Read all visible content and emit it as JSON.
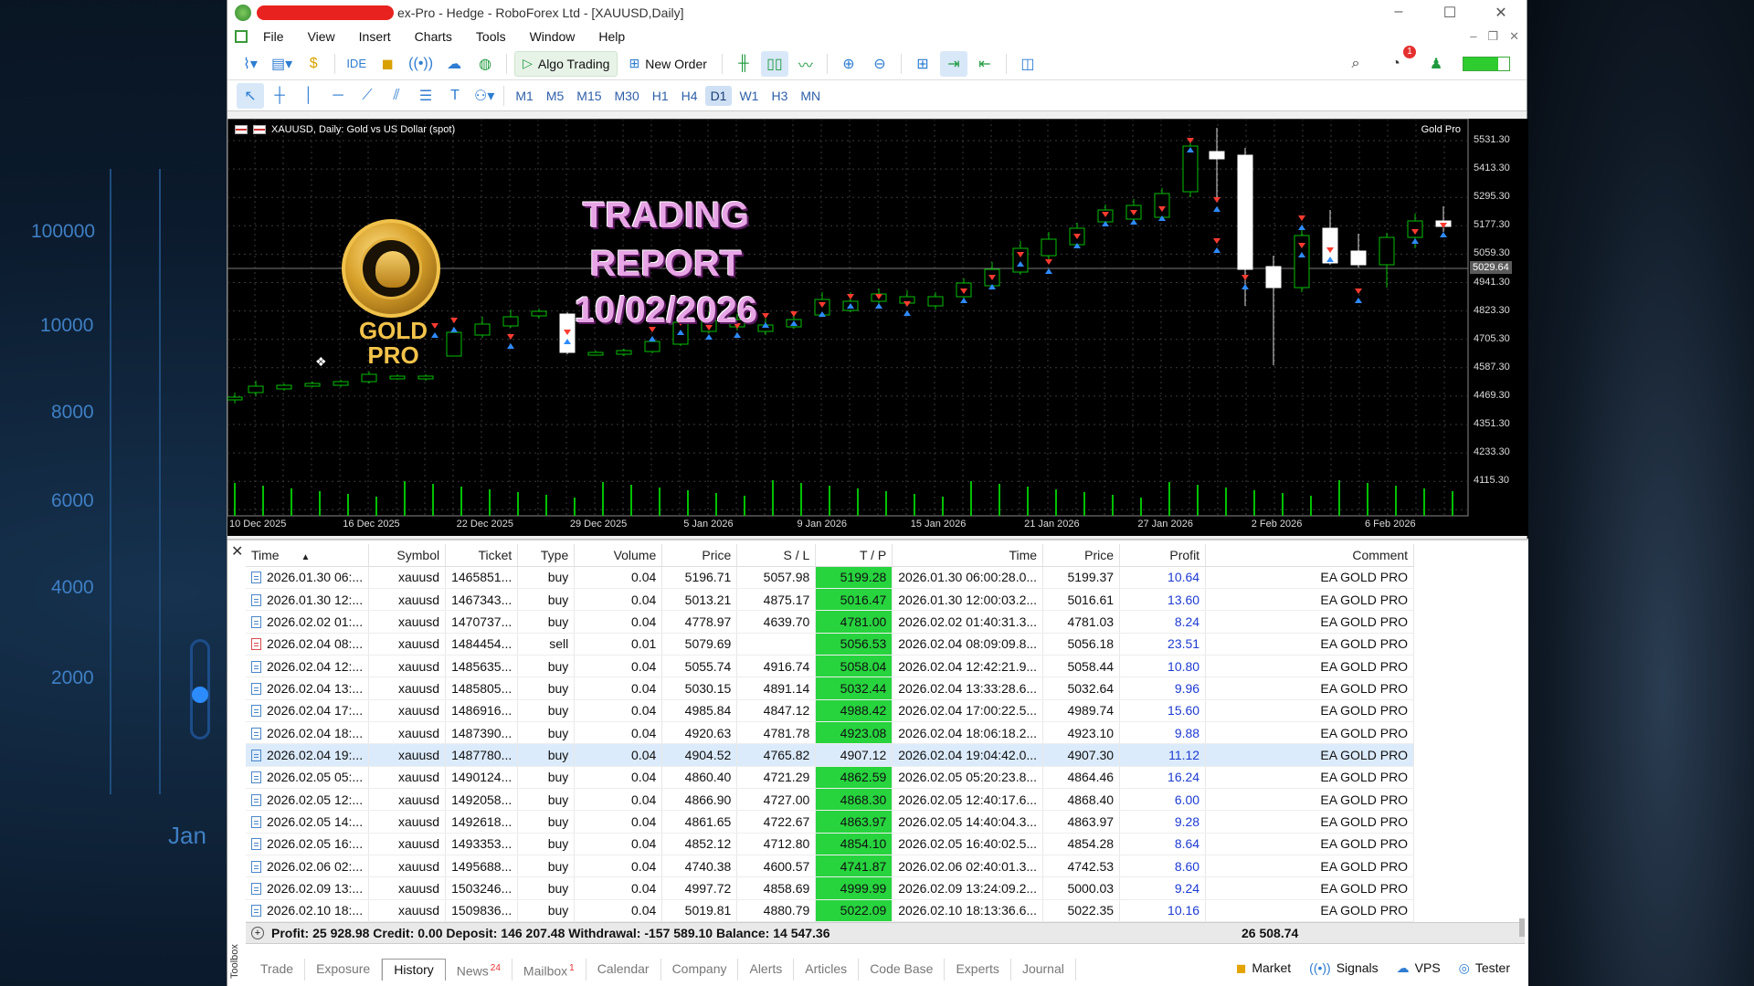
{
  "background": {
    "axis_labels": [
      "100000",
      "10000",
      "8000",
      "6000",
      "4000",
      "2000",
      "Jan"
    ]
  },
  "window": {
    "title": "ex-Pro - Hedge - RoboForex Ltd - [XAUUSD,Daily]",
    "controls": [
      "–",
      "☐",
      "✕"
    ]
  },
  "menu": [
    "File",
    "View",
    "Insert",
    "Charts",
    "Tools",
    "Window",
    "Help"
  ],
  "toolbar": {
    "ide_label": "IDE",
    "algo_trading_label": "Algo Trading",
    "new_order_label": "New Order",
    "notification_count": "1"
  },
  "timeframes": [
    "M1",
    "M5",
    "M15",
    "M30",
    "H1",
    "H4",
    "D1",
    "W1",
    "H3",
    "MN"
  ],
  "chart": {
    "header": "XAUUSD, Daily:  Gold vs US Dollar (spot)",
    "ea_name": "Gold Pro",
    "current_price": "5029.64",
    "y_ticks": [
      "5531.30",
      "5413.30",
      "5295.30",
      "5177.30",
      "5059.30",
      "4941.30",
      "4823.30",
      "4705.30",
      "4587.30",
      "4469.30",
      "4351.30",
      "4233.30",
      "4115.30"
    ],
    "x_ticks": [
      "10 Dec 2025",
      "16 Dec 2025",
      "22 Dec 2025",
      "29 Dec 2025",
      "5 Jan 2026",
      "9 Jan 2026",
      "15 Jan 2026",
      "21 Jan 2026",
      "27 Jan 2026",
      "2 Feb 2026",
      "6 Feb 2026"
    ],
    "overlay": {
      "logo_line1": "GOLD",
      "logo_line2": "PRO",
      "report_line1": "TRADING",
      "report_line2": "REPORT",
      "report_line3": "10/02/2026"
    },
    "colors": {
      "background": "#000000",
      "bull": "#00c000",
      "bear_body": "#ffffff",
      "grid": "#3a3a3a"
    }
  },
  "history": {
    "columns": [
      "Time",
      "Symbol",
      "Ticket",
      "Type",
      "Volume",
      "Price",
      "S / L",
      "T / P",
      "Time",
      "Price",
      "Profit",
      "Comment"
    ],
    "rows": [
      {
        "open_time": "2026.01.30 06:...",
        "symbol": "xauusd",
        "ticket": "1465851...",
        "type": "buy",
        "volume": "0.04",
        "price": "5196.71",
        "sl": "5057.98",
        "tp": "5199.28",
        "close_time": "2026.01.30 06:00:28.0...",
        "close_price": "5199.37",
        "profit": "10.64",
        "comment": "EA GOLD PRO"
      },
      {
        "open_time": "2026.01.30 12:...",
        "symbol": "xauusd",
        "ticket": "1467343...",
        "type": "buy",
        "volume": "0.04",
        "price": "5013.21",
        "sl": "4875.17",
        "tp": "5016.47",
        "close_time": "2026.01.30 12:00:03.2...",
        "close_price": "5016.61",
        "profit": "13.60",
        "comment": "EA GOLD PRO"
      },
      {
        "open_time": "2026.02.02 01:...",
        "symbol": "xauusd",
        "ticket": "1470737...",
        "type": "buy",
        "volume": "0.04",
        "price": "4778.97",
        "sl": "4639.70",
        "tp": "4781.00",
        "close_time": "2026.02.02 01:40:31.3...",
        "close_price": "4781.03",
        "profit": "8.24",
        "comment": "EA GOLD PRO"
      },
      {
        "open_time": "2026.02.04 08:...",
        "symbol": "xauusd",
        "ticket": "1484454...",
        "type": "sell",
        "volume": "0.01",
        "price": "5079.69",
        "sl": "",
        "tp": "5056.53",
        "close_time": "2026.02.04 08:09:09.8...",
        "close_price": "5056.18",
        "profit": "23.51",
        "comment": "EA GOLD PRO"
      },
      {
        "open_time": "2026.02.04 12:...",
        "symbol": "xauusd",
        "ticket": "1485635...",
        "type": "buy",
        "volume": "0.04",
        "price": "5055.74",
        "sl": "4916.74",
        "tp": "5058.04",
        "close_time": "2026.02.04 12:42:21.9...",
        "close_price": "5058.44",
        "profit": "10.80",
        "comment": "EA GOLD PRO"
      },
      {
        "open_time": "2026.02.04 13:...",
        "symbol": "xauusd",
        "ticket": "1485805...",
        "type": "buy",
        "volume": "0.04",
        "price": "5030.15",
        "sl": "4891.14",
        "tp": "5032.44",
        "close_time": "2026.02.04 13:33:28.6...",
        "close_price": "5032.64",
        "profit": "9.96",
        "comment": "EA GOLD PRO"
      },
      {
        "open_time": "2026.02.04 17:...",
        "symbol": "xauusd",
        "ticket": "1486916...",
        "type": "buy",
        "volume": "0.04",
        "price": "4985.84",
        "sl": "4847.12",
        "tp": "4988.42",
        "close_time": "2026.02.04 17:00:22.5...",
        "close_price": "4989.74",
        "profit": "15.60",
        "comment": "EA GOLD PRO"
      },
      {
        "open_time": "2026.02.04 18:...",
        "symbol": "xauusd",
        "ticket": "1487390...",
        "type": "buy",
        "volume": "0.04",
        "price": "4920.63",
        "sl": "4781.78",
        "tp": "4923.08",
        "close_time": "2026.02.04 18:06:18.2...",
        "close_price": "4923.10",
        "profit": "9.88",
        "comment": "EA GOLD PRO"
      },
      {
        "open_time": "2026.02.04 19:...",
        "symbol": "xauusd",
        "ticket": "1487780...",
        "type": "buy",
        "volume": "0.04",
        "price": "4904.52",
        "sl": "4765.82",
        "tp": "4907.12",
        "close_time": "2026.02.04 19:04:42.0...",
        "close_price": "4907.30",
        "profit": "11.12",
        "comment": "EA GOLD PRO"
      },
      {
        "open_time": "2026.02.05 05:...",
        "symbol": "xauusd",
        "ticket": "1490124...",
        "type": "buy",
        "volume": "0.04",
        "price": "4860.40",
        "sl": "4721.29",
        "tp": "4862.59",
        "close_time": "2026.02.05 05:20:23.8...",
        "close_price": "4864.46",
        "profit": "16.24",
        "comment": "EA GOLD PRO"
      },
      {
        "open_time": "2026.02.05 12:...",
        "symbol": "xauusd",
        "ticket": "1492058...",
        "type": "buy",
        "volume": "0.04",
        "price": "4866.90",
        "sl": "4727.00",
        "tp": "4868.30",
        "close_time": "2026.02.05 12:40:17.6...",
        "close_price": "4868.40",
        "profit": "6.00",
        "comment": "EA GOLD PRO"
      },
      {
        "open_time": "2026.02.05 14:...",
        "symbol": "xauusd",
        "ticket": "1492618...",
        "type": "buy",
        "volume": "0.04",
        "price": "4861.65",
        "sl": "4722.67",
        "tp": "4863.97",
        "close_time": "2026.02.05 14:40:04.3...",
        "close_price": "4863.97",
        "profit": "9.28",
        "comment": "EA GOLD PRO"
      },
      {
        "open_time": "2026.02.05 16:...",
        "symbol": "xauusd",
        "ticket": "1493353...",
        "type": "buy",
        "volume": "0.04",
        "price": "4852.12",
        "sl": "4712.80",
        "tp": "4854.10",
        "close_time": "2026.02.05 16:40:02.5...",
        "close_price": "4854.28",
        "profit": "8.64",
        "comment": "EA GOLD PRO"
      },
      {
        "open_time": "2026.02.06 02:...",
        "symbol": "xauusd",
        "ticket": "1495688...",
        "type": "buy",
        "volume": "0.04",
        "price": "4740.38",
        "sl": "4600.57",
        "tp": "4741.87",
        "close_time": "2026.02.06 02:40:01.3...",
        "close_price": "4742.53",
        "profit": "8.60",
        "comment": "EA GOLD PRO"
      },
      {
        "open_time": "2026.02.09 13:...",
        "symbol": "xauusd",
        "ticket": "1503246...",
        "type": "buy",
        "volume": "0.04",
        "price": "4997.72",
        "sl": "4858.69",
        "tp": "4999.99",
        "close_time": "2026.02.09 13:24:09.2...",
        "close_price": "5000.03",
        "profit": "9.24",
        "comment": "EA GOLD PRO"
      },
      {
        "open_time": "2026.02.10 18:...",
        "symbol": "xauusd",
        "ticket": "1509836...",
        "type": "buy",
        "volume": "0.04",
        "price": "5019.81",
        "sl": "4880.79",
        "tp": "5022.09",
        "close_time": "2026.02.10 18:13:36.6...",
        "close_price": "5022.35",
        "profit": "10.16",
        "comment": "EA GOLD PRO"
      }
    ],
    "summary": "Profit: 25 928.98  Credit: 0.00  Deposit: 146 207.48  Withdrawal: -157 589.10  Balance: 14 547.36",
    "summary_total": "26 508.74"
  },
  "toolbox": {
    "label": "Toolbox",
    "tabs": [
      {
        "label": "Trade",
        "badge": ""
      },
      {
        "label": "Exposure",
        "badge": ""
      },
      {
        "label": "History",
        "badge": ""
      },
      {
        "label": "News",
        "badge": "24"
      },
      {
        "label": "Mailbox",
        "badge": "1"
      },
      {
        "label": "Calendar",
        "badge": ""
      },
      {
        "label": "Company",
        "badge": ""
      },
      {
        "label": "Alerts",
        "badge": ""
      },
      {
        "label": "Articles",
        "badge": ""
      },
      {
        "label": "Code Base",
        "badge": ""
      },
      {
        "label": "Experts",
        "badge": ""
      },
      {
        "label": "Journal",
        "badge": ""
      }
    ],
    "status": [
      "Market",
      "Signals",
      "VPS",
      "Tester"
    ]
  }
}
